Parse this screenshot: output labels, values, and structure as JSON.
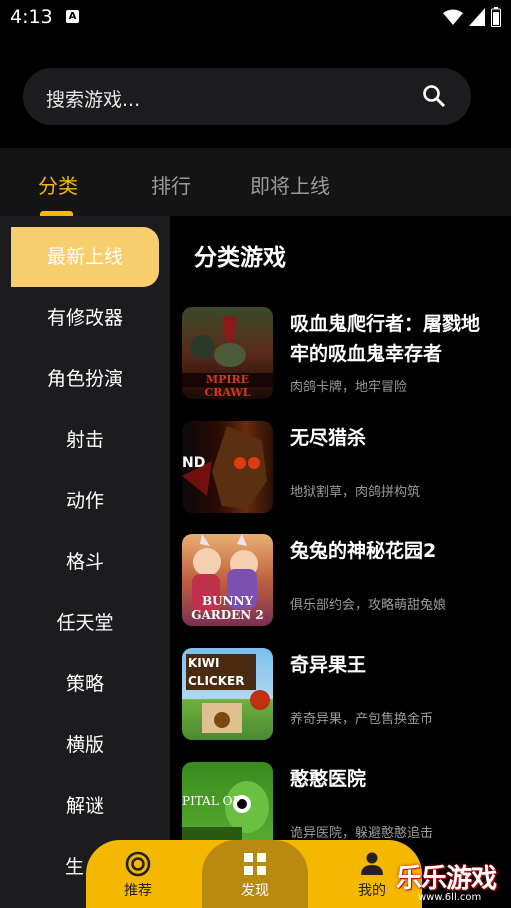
{
  "status": {
    "time": "4:13",
    "badge": "A"
  },
  "search": {
    "placeholder": "搜索游戏..."
  },
  "tabs": [
    {
      "label": "分类",
      "active": true
    },
    {
      "label": "排行",
      "active": false
    },
    {
      "label": "即将上线",
      "active": false
    }
  ],
  "sidebar": {
    "items": [
      {
        "label": "最新上线",
        "active": true
      },
      {
        "label": "有修改器"
      },
      {
        "label": "角色扮演"
      },
      {
        "label": "射击"
      },
      {
        "label": "动作"
      },
      {
        "label": "格斗"
      },
      {
        "label": "任天堂"
      },
      {
        "label": "策略"
      },
      {
        "label": "横版"
      },
      {
        "label": "解谜"
      },
      {
        "label": "生"
      }
    ]
  },
  "main": {
    "title": "分类游戏",
    "games": [
      {
        "title": "吸血鬼爬行者：屠戮地牢的吸血鬼幸存者",
        "desc": "肉鸽卡牌，地牢冒险",
        "thumb_text": "MPIRE CRAWL"
      },
      {
        "title": "无尽猎杀",
        "desc": "地狱割草，肉鸽拼构筑",
        "thumb_text": "ND"
      },
      {
        "title": "兔兔的神秘花园2",
        "desc": "俱乐部约会，攻略萌甜兔娘",
        "thumb_text": "BUNNY GARDEN 2"
      },
      {
        "title": "奇异果王",
        "desc": "养奇异果，产包售换金币",
        "thumb_text": "KIWI CLICKER"
      },
      {
        "title": "憨憨医院",
        "desc": "诡异医院，躲避憨憨追击",
        "thumb_text": "PITAL OF"
      }
    ]
  },
  "bottom_nav": {
    "items": [
      {
        "label": "推荐",
        "icon": "target-icon"
      },
      {
        "label": "发现",
        "icon": "grid-icon",
        "active": true
      },
      {
        "label": "我的",
        "icon": "person-icon"
      }
    ]
  },
  "watermark": {
    "text": "乐乐游戏",
    "url": "www.6ll.com"
  },
  "colors": {
    "accent": "#f5b800",
    "sidebar_active": "#f8cd6e",
    "nav_active": "#b88a10"
  }
}
